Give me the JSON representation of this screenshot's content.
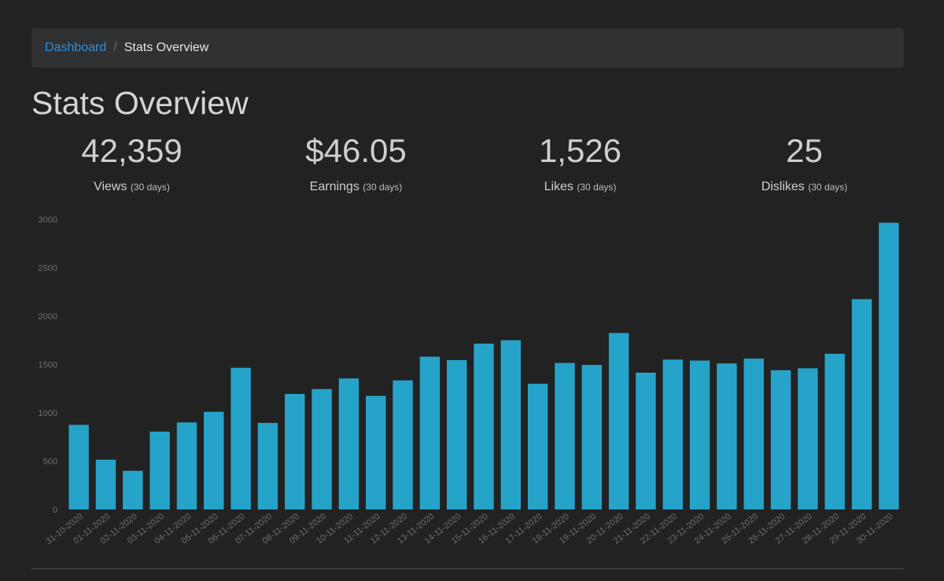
{
  "breadcrumb": {
    "link": "Dashboard",
    "separator": "/",
    "current": "Stats Overview"
  },
  "page": {
    "title": "Stats Overview"
  },
  "stats": [
    {
      "value": "42,359",
      "label": "Views",
      "period": "(30 days)"
    },
    {
      "value": "$46.05",
      "label": "Earnings",
      "period": "(30 days)"
    },
    {
      "value": "1,526",
      "label": "Likes",
      "period": "(30 days)"
    },
    {
      "value": "25",
      "label": "Dislikes",
      "period": "(30 days)"
    }
  ],
  "colors": {
    "background": "#222222",
    "bar": "#26a3c9",
    "link": "#2d8fdc"
  },
  "chart_data": {
    "type": "bar",
    "categories": [
      "31-10-2020",
      "01-11-2020",
      "02-11-2020",
      "03-11-2020",
      "04-11-2020",
      "05-11-2020",
      "06-11-2020",
      "07-11-2020",
      "08-11-2020",
      "09-11-2020",
      "10-11-2020",
      "11-11-2020",
      "12-11-2020",
      "13-11-2020",
      "14-11-2020",
      "15-11-2020",
      "16-11-2020",
      "17-11-2020",
      "18-11-2020",
      "19-11-2020",
      "20-11-2020",
      "21-11-2020",
      "22-11-2020",
      "23-11-2020",
      "24-11-2020",
      "25-11-2020",
      "26-11-2020",
      "27-11-2020",
      "28-11-2020",
      "29-11-2020",
      "30-11-2020"
    ],
    "values": [
      875,
      515,
      400,
      805,
      900,
      1010,
      1465,
      895,
      1195,
      1245,
      1355,
      1175,
      1335,
      1580,
      1545,
      1715,
      1750,
      1300,
      1515,
      1495,
      1825,
      1415,
      1550,
      1540,
      1510,
      1560,
      1440,
      1460,
      1610,
      2175,
      2965
    ],
    "ylim": [
      0,
      3000
    ],
    "yticks": [
      0,
      500,
      1000,
      1500,
      2000,
      2500,
      3000
    ],
    "grid": false,
    "legend": "none"
  }
}
